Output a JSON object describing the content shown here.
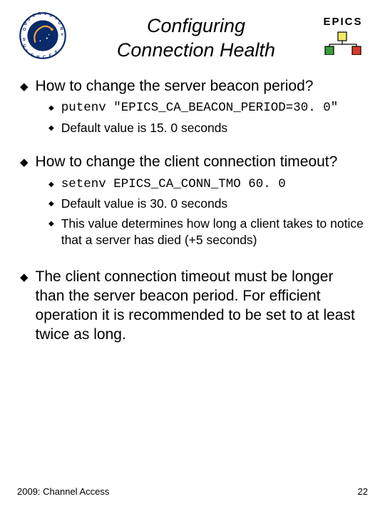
{
  "title": {
    "line1": "Configuring",
    "line2": "Connection Health"
  },
  "epics_label": "EPICS",
  "b1": {
    "text": "How to change the server beacon period?",
    "s1": "putenv \"EPICS_CA_BEACON_PERIOD=30. 0\"",
    "s2": "Default value is 15. 0 seconds"
  },
  "b2": {
    "text": "How to change the client connection timeout?",
    "s1": "setenv EPICS_CA_CONN_TMO 60. 0",
    "s2": "Default value is 30. 0 seconds",
    "s3": "This value determines how long a client takes to notice that a server has died (+5 seconds)"
  },
  "b3": {
    "text": "The client connection timeout must be longer than the server beacon period. For efficient operation it is recommended to be set to at least twice as long."
  },
  "footer": {
    "left": "2009: Channel Access",
    "right": "22"
  }
}
